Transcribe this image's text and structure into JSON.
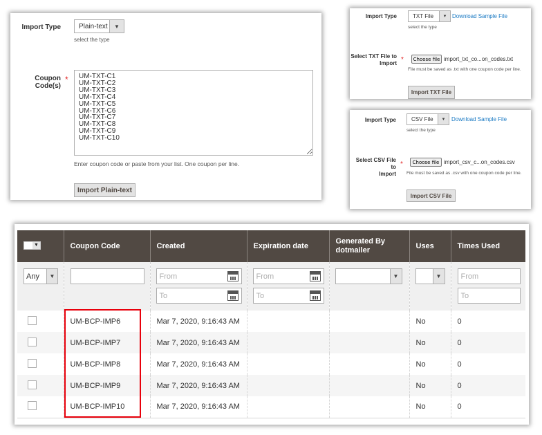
{
  "plain_text_panel": {
    "import_type_label": "Import Type",
    "import_type_value": "Plain-text",
    "import_type_note": "select the type",
    "coupon_codes_label": "Coupon Code(s)",
    "required_mark": "*",
    "coupon_codes_value": "UM-TXT-C1\nUM-TXT-C2\nUM-TXT-C3\nUM-TXT-C4\nUM-TXT-C5\nUM-TXT-C6\nUM-TXT-C7\nUM-TXT-C8\nUM-TXT-C9\nUM-TXT-C10",
    "coupon_codes_note": "Enter coupon code or paste from your list. One coupon per line.",
    "import_button": "Import Plain-text"
  },
  "txt_panel": {
    "import_type_label": "Import Type",
    "import_type_value": "TXT File",
    "download_link": "Download Sample File",
    "import_type_note": "select the type",
    "file_label_line1": "Select TXT File to",
    "file_label_line2": "Import",
    "required_mark": "*",
    "choose_file_button": "Choose file",
    "file_name": "import_txt_co...on_codes.txt",
    "file_note": "File must be saved as .txt with one coupon code per line.",
    "import_button": "Import TXT File"
  },
  "csv_panel": {
    "import_type_label": "Import Type",
    "import_type_value": "CSV File",
    "download_link": "Download Sample File",
    "import_type_note": "select the type",
    "file_label_line1": "Select CSV File to",
    "file_label_line2": "Import",
    "required_mark": "*",
    "choose_file_button": "Choose file",
    "file_name": "import_csv_c...on_codes.csv",
    "file_note": "File must be saved as .csv with one coupon code per line.",
    "import_button": "Import CSV File"
  },
  "grid": {
    "columns": [
      "",
      "Coupon Code",
      "Created",
      "Expiration date",
      "Generated By dotmailer",
      "Uses",
      "Times Used"
    ],
    "filters": {
      "mass_select": "Any",
      "coupon_code": "",
      "created_from_placeholder": "From",
      "created_to_placeholder": "To",
      "expiration_from_placeholder": "From",
      "expiration_to_placeholder": "To",
      "generated_by": "",
      "uses": "",
      "times_used_from_placeholder": "From",
      "times_used_to_placeholder": "To"
    },
    "rows": [
      {
        "code": "UM-BCP-IMP6",
        "created": "Mar 7, 2020, 9:16:43 AM",
        "expiration": "",
        "generated_by": "",
        "uses": "No",
        "times_used": "0"
      },
      {
        "code": "UM-BCP-IMP7",
        "created": "Mar 7, 2020, 9:16:43 AM",
        "expiration": "",
        "generated_by": "",
        "uses": "No",
        "times_used": "0"
      },
      {
        "code": "UM-BCP-IMP8",
        "created": "Mar 7, 2020, 9:16:43 AM",
        "expiration": "",
        "generated_by": "",
        "uses": "No",
        "times_used": "0"
      },
      {
        "code": "UM-BCP-IMP9",
        "created": "Mar 7, 2020, 9:16:43 AM",
        "expiration": "",
        "generated_by": "",
        "uses": "No",
        "times_used": "0"
      },
      {
        "code": "UM-BCP-IMP10",
        "created": "Mar 7, 2020, 9:16:43 AM",
        "expiration": "",
        "generated_by": "",
        "uses": "No",
        "times_used": "0"
      }
    ]
  },
  "colors": {
    "header_bg": "#514943",
    "link": "#1979c3",
    "required": "#e22626",
    "highlight": "#e8000b"
  }
}
